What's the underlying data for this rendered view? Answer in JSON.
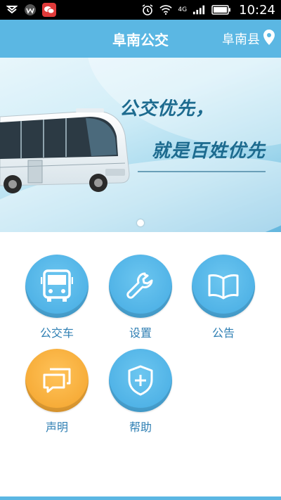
{
  "status_bar": {
    "time": "10:24",
    "network": "4G",
    "left_icons": [
      "notification-icon",
      "wallpaper-icon",
      "wechat-icon"
    ],
    "right_icons": [
      "alarm-icon",
      "wifi-icon",
      "signal-icon",
      "battery-icon"
    ]
  },
  "header": {
    "title": "阜南公交",
    "location": "阜南县",
    "location_icon": "location-pin-icon"
  },
  "banner": {
    "slogan_line1": "公交优先，",
    "slogan_line2": "就是百姓优先",
    "pager_total": 1,
    "pager_active": 1
  },
  "menu": {
    "items": [
      {
        "label": "公交车",
        "icon": "bus-icon",
        "color": "#4fb2e6"
      },
      {
        "label": "设置",
        "icon": "wrench-icon",
        "color": "#4fb2e6"
      },
      {
        "label": "公告",
        "icon": "book-icon",
        "color": "#4fb2e6"
      },
      {
        "label": "声明",
        "icon": "chat-bubbles-icon",
        "color": "#f6ab37"
      },
      {
        "label": "帮助",
        "icon": "shield-plus-icon",
        "color": "#4fb2e6"
      }
    ]
  },
  "colors": {
    "primary": "#5bb7e3",
    "accent_orange": "#f6ab37",
    "label_blue": "#2f7fb3"
  }
}
